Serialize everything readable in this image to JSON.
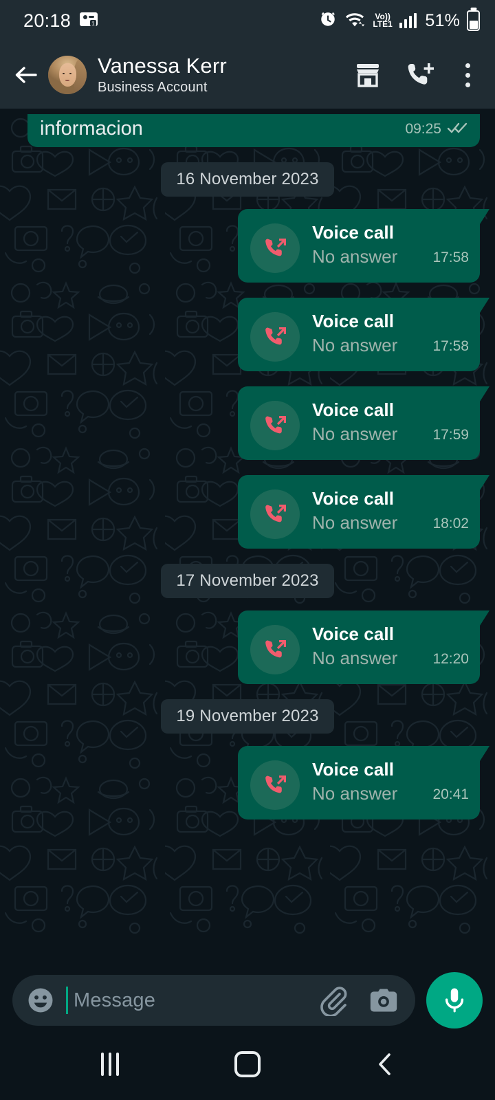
{
  "status_bar": {
    "clock": "20:18",
    "battery_percent": "51%",
    "network_label_top": "Vo))",
    "network_label_bottom": "LTE1",
    "icons": [
      "screen-record-icon",
      "alarm-icon",
      "wifi-icon",
      "volte-icon",
      "signal-icon",
      "battery-icon"
    ]
  },
  "header": {
    "name": "Vanessa Kerr",
    "subtitle": "Business Account",
    "back_icon": "back-arrow-icon",
    "avatar": "contact-avatar",
    "actions": [
      "shop-icon",
      "add-call-icon",
      "more-options-icon"
    ]
  },
  "chat": {
    "partial_message": {
      "text": "informacion",
      "time": "09:25",
      "status": "read-receipt-double-check"
    },
    "items": [
      {
        "type": "date",
        "label": "16 November 2023"
      },
      {
        "type": "call",
        "title": "Voice call",
        "status": "No answer",
        "time": "17:58",
        "icon": "outgoing-call-icon"
      },
      {
        "type": "call",
        "title": "Voice call",
        "status": "No answer",
        "time": "17:58",
        "icon": "outgoing-call-icon"
      },
      {
        "type": "call",
        "title": "Voice call",
        "status": "No answer",
        "time": "17:59",
        "icon": "outgoing-call-icon"
      },
      {
        "type": "call",
        "title": "Voice call",
        "status": "No answer",
        "time": "18:02",
        "icon": "outgoing-call-icon"
      },
      {
        "type": "date",
        "label": "17 November 2023"
      },
      {
        "type": "call",
        "title": "Voice call",
        "status": "No answer",
        "time": "12:20",
        "icon": "outgoing-call-icon"
      },
      {
        "type": "date",
        "label": "19 November 2023"
      },
      {
        "type": "call",
        "title": "Voice call",
        "status": "No answer",
        "time": "20:41",
        "icon": "outgoing-call-icon"
      }
    ]
  },
  "input_bar": {
    "placeholder": "Message",
    "emoji_icon": "emoji-icon",
    "attach_icon": "attachment-icon",
    "camera_icon": "camera-icon",
    "mic_icon": "microphone-icon"
  },
  "nav_bar": {
    "recents": "recents-icon",
    "home": "home-icon",
    "back": "back-icon"
  },
  "colors": {
    "outgoing_bubble": "#005c4b",
    "header_bg": "#202c33",
    "chat_bg": "#0b141a",
    "accent_green": "#00a884",
    "call_icon_red": "#f15c6d",
    "date_chip_bg": "#1f2c33",
    "muted_text": "#8696a0"
  }
}
